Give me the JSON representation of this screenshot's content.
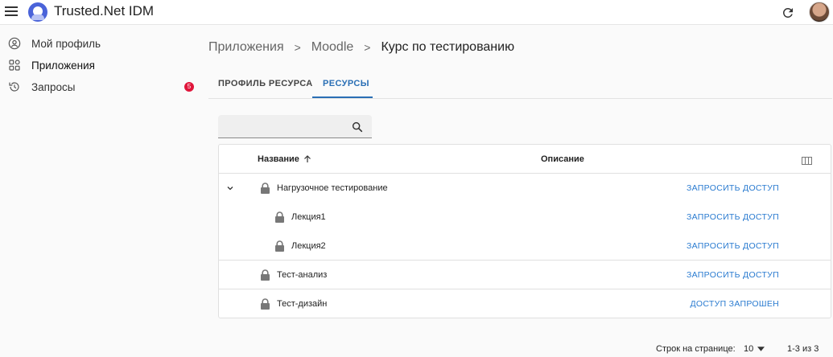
{
  "header": {
    "app_title": "Trusted.Net IDM",
    "menu_icon": "menu-icon",
    "logo_icon": "user-logo-icon",
    "refresh_icon": "refresh-icon",
    "avatar": "user-avatar"
  },
  "sidebar": {
    "items": [
      {
        "label": "Мой профиль",
        "icon": "account-circle-icon",
        "active": false
      },
      {
        "label": "Приложения",
        "icon": "apps-grid-icon",
        "active": true
      },
      {
        "label": "Запросы",
        "icon": "history-icon",
        "active": false,
        "badge": "5"
      }
    ]
  },
  "breadcrumb": {
    "items": [
      "Приложения",
      "Moodle",
      "Курс по тестированию"
    ],
    "separator": ">"
  },
  "tabs": [
    {
      "label": "ПРОФИЛЬ РЕСУРСА",
      "active": false
    },
    {
      "label": "РЕСУРСЫ",
      "active": true
    }
  ],
  "search": {
    "value": "",
    "placeholder": "",
    "icon": "search-icon"
  },
  "table": {
    "columns": {
      "name": "Название",
      "description": "Описание"
    },
    "sort_icon": "arrow-up-icon",
    "settings_icon": "columns-icon",
    "rows": [
      {
        "name": "Нагрузочное тестирование",
        "action": "ЗАПРОСИТЬ ДОСТУП",
        "level": 0,
        "expanded": true
      },
      {
        "name": "Лекция1",
        "action": "ЗАПРОСИТЬ ДОСТУП",
        "level": 1
      },
      {
        "name": "Лекция2",
        "action": "ЗАПРОСИТЬ ДОСТУП",
        "level": 1
      },
      {
        "name": "Тест-анализ",
        "action": "ЗАПРОСИТЬ ДОСТУП",
        "level": 0
      },
      {
        "name": "Тест-дизайн",
        "action": "ДОСТУП ЗАПРОШЕН",
        "level": 0
      }
    ]
  },
  "pagination": {
    "rows_per_page_label": "Строк на странице:",
    "rows_per_page": "10",
    "range": "1-3 из 3"
  },
  "colors": {
    "accent": "#2a6fb5",
    "badge": "#e0153a"
  }
}
